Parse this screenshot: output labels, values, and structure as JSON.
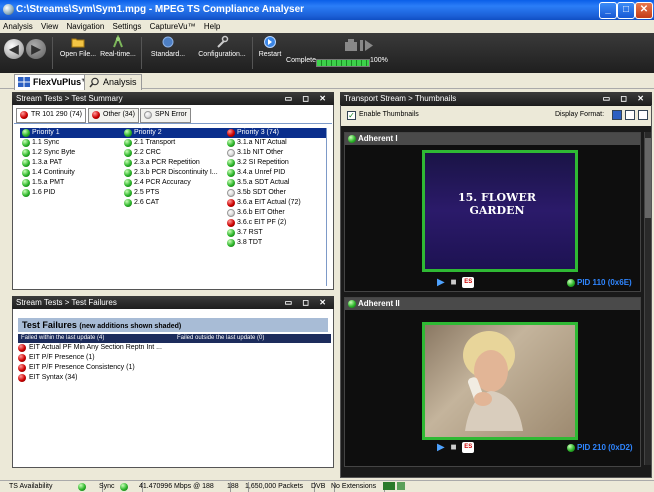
{
  "window": {
    "title": "C:\\Streams\\Sym\\Sym1.mpg - MPEG TS Compliance Analyser"
  },
  "menu": [
    "Analysis",
    "View",
    "Navigation",
    "Settings",
    "CaptureVu™",
    "Help"
  ],
  "toolbar": {
    "items": [
      {
        "label": "Open File...",
        "icon": "folder-icon"
      },
      {
        "label": "Real-time...",
        "icon": "antenna-icon"
      },
      {
        "label": "Standard...",
        "icon": "globe-icon"
      },
      {
        "label": "Configuration...",
        "icon": "wrench-icon"
      },
      {
        "label": "Restart",
        "icon": "restart-icon"
      },
      {
        "label": "Complete",
        "icon": "progress"
      }
    ],
    "progress_percent_text": "100%",
    "progress_fraction": 1.0
  },
  "app_tabs": [
    {
      "label": "FlexVuPlus™",
      "active": true
    },
    {
      "label": "Analysis",
      "active": false
    }
  ],
  "summary_panel": {
    "title": "Stream Tests > Test Summary",
    "tabs": [
      {
        "label": "TR 101 290 (74)",
        "status": "red",
        "active": true
      },
      {
        "label": "Other (34)",
        "status": "red",
        "active": false
      },
      {
        "label": "SPN Error",
        "status": "gray",
        "active": false
      }
    ],
    "columns": [
      {
        "header": "Priority 1",
        "status": "green",
        "items": [
          {
            "label": "1.1 Sync",
            "status": "green"
          },
          {
            "label": "1.2 Sync Byte",
            "status": "green"
          },
          {
            "label": "1.3.a PAT",
            "status": "green"
          },
          {
            "label": "1.4 Continuity",
            "status": "green"
          },
          {
            "label": "1.5.a PMT",
            "status": "green"
          },
          {
            "label": "1.6 PID",
            "status": "green"
          }
        ]
      },
      {
        "header": "Priority 2",
        "status": "green",
        "items": [
          {
            "label": "2.1 Transport",
            "status": "green"
          },
          {
            "label": "2.2 CRC",
            "status": "green"
          },
          {
            "label": "2.3.a PCR Repetition",
            "status": "green"
          },
          {
            "label": "2.3.b PCR Discontinuity I...",
            "status": "green"
          },
          {
            "label": "2.4 PCR Accuracy",
            "status": "green"
          },
          {
            "label": "2.5 PTS",
            "status": "green"
          },
          {
            "label": "2.6 CAT",
            "status": "green"
          }
        ]
      },
      {
        "header": "Priority 3 (74)",
        "status": "red",
        "items": [
          {
            "label": "3.1.a NIT Actual",
            "status": "green"
          },
          {
            "label": "3.1b NIT Other",
            "status": "gray"
          },
          {
            "label": "3.2 SI Repetition",
            "status": "green"
          },
          {
            "label": "3.4.a Unref PID",
            "status": "green"
          },
          {
            "label": "3.5.a SDT Actual",
            "status": "green"
          },
          {
            "label": "3.5b SDT Other",
            "status": "gray"
          },
          {
            "label": "3.6.a EIT Actual (72)",
            "status": "red"
          },
          {
            "label": "3.6.b EIT Other",
            "status": "gray"
          },
          {
            "label": "3.6.c EIT PF (2)",
            "status": "red"
          },
          {
            "label": "3.7 RST",
            "status": "green"
          },
          {
            "label": "3.8 TDT",
            "status": "green"
          }
        ]
      }
    ]
  },
  "failures_panel": {
    "title": "Stream Tests > Test Failures",
    "heading": "Test Failures",
    "heading_note": "(new additions shown shaded)",
    "col_within": "Failed within the last update (4)",
    "col_outside": "Failed outside the last update (0)",
    "items": [
      "EIT Actual PF Min Any Section Reptn Int ...",
      "EIT P/F Presence (1)",
      "EIT P/F Presence Consistency (1)",
      "EIT Syntax (34)"
    ]
  },
  "thumbs_panel": {
    "title": "Transport Stream > Thumbnails",
    "enable_label": "Enable Thumbnails",
    "enabled": true,
    "display_format_label": "Display Format:",
    "items": [
      {
        "name": "Adherent I",
        "caption": "15. FLOWER GARDEN",
        "pid": "PID 110 (0x6E)",
        "status": "green"
      },
      {
        "name": "Adherent II",
        "caption": "",
        "pid": "PID 210 (0xD2)",
        "status": "green"
      }
    ]
  },
  "statusbar": {
    "ts_availability": "TS Availability",
    "sync": "Sync",
    "bitrate": "41.470996 Mbps @ 188",
    "packet_size": "188",
    "packets": "1,650,000 Packets",
    "standard": "DVB",
    "extensions": "No Extensions"
  },
  "colors": {
    "ok": "#2db52a",
    "error": "#cc0000",
    "header_blue": "#0a2e8c",
    "thumb_border": "#2fb934"
  }
}
